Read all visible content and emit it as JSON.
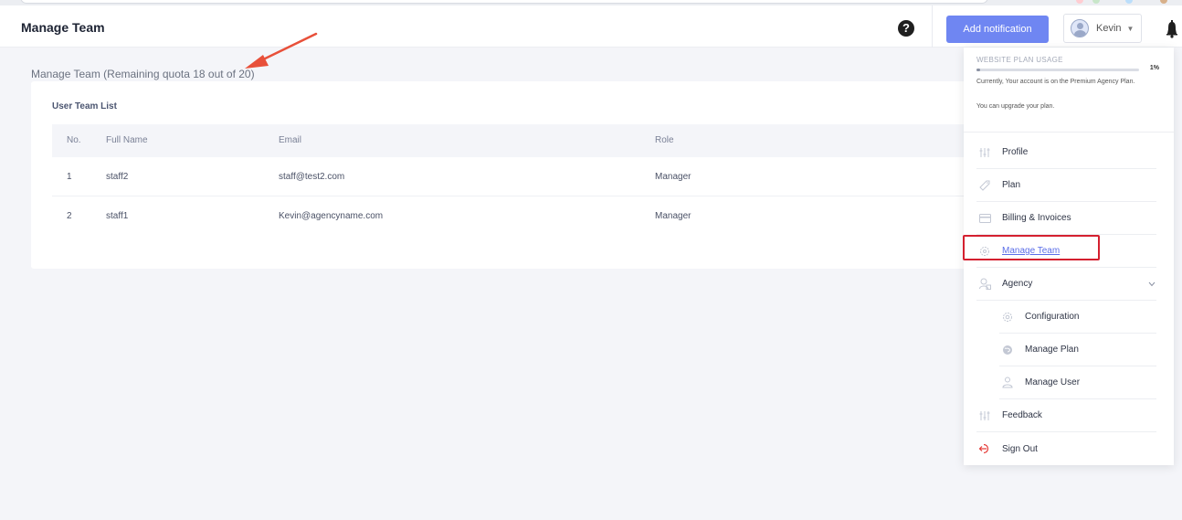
{
  "header": {
    "title": "Manage Team",
    "help_icon": "question-circle-icon",
    "add_notification_label": "Add notification",
    "user_name": "Kevin"
  },
  "quota_heading": "Manage Team (Remaining quota 18 out of 20)",
  "team_list": {
    "title": "User Team List",
    "columns": [
      "No.",
      "Full Name",
      "Email",
      "Role"
    ],
    "rows": [
      {
        "no": "1",
        "name": "staff2",
        "email": "staff@test2.com",
        "role": "Manager"
      },
      {
        "no": "2",
        "name": "staff1",
        "email": "Kevin@agencyname.com",
        "role": "Manager"
      }
    ]
  },
  "dropdown": {
    "usage_label": "WEBSITE PLAN USAGE",
    "usage_percent_text": "1%",
    "usage_fraction": 0.01,
    "usage_description": "Currently, Your account is on the Premium Agency Plan.",
    "upgrade_text": "You can upgrade your plan.",
    "items": [
      {
        "label": "Profile",
        "icon": "sliders-icon"
      },
      {
        "label": "Plan",
        "icon": "tag-icon"
      },
      {
        "label": "Billing & Invoices",
        "icon": "credit-card-icon"
      },
      {
        "label": "Manage Team",
        "icon": "team-gear-icon",
        "active": true
      },
      {
        "label": "Agency",
        "icon": "agency-user-icon",
        "expandable": true
      },
      {
        "label": "Configuration",
        "icon": "gear-icon",
        "sub": true
      },
      {
        "label": "Manage Plan",
        "icon": "plan-globe-icon",
        "sub": true
      },
      {
        "label": "Manage User",
        "icon": "user-icon",
        "sub": true
      },
      {
        "label": "Feedback",
        "icon": "sliders-icon"
      },
      {
        "label": "Sign Out",
        "icon": "sign-out-icon",
        "color": "#e53935"
      }
    ]
  },
  "colors": {
    "accent": "#6f86f2",
    "active_link": "#5b6ee8",
    "highlight_box": "#d4202f",
    "arrow": "#e8503a"
  }
}
